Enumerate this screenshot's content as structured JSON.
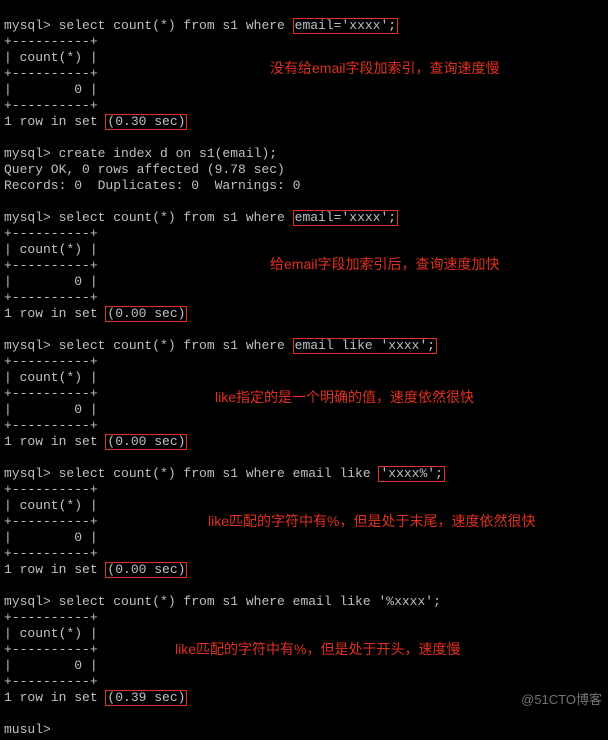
{
  "common": {
    "prompt": "mysql>",
    "divider": "+----------+",
    "header": "| count(*) |",
    "value": "|        0 |",
    "rowPrefix": "1 row in set "
  },
  "queries": {
    "q1_before": "mysql> select count(*) from s1 where ",
    "q1_box": "email='xxxx';",
    "q1_time": "(0.30 sec)",
    "createIdx": "mysql> create index d on s1(email);",
    "createOut1": "Query OK, 0 rows affected (9.78 sec)",
    "createOut2": "Records: 0  Duplicates: 0  Warnings: 0",
    "q2_before": "mysql> select count(*) from s1 where ",
    "q2_box": "email='xxxx';",
    "q2_time": "(0.00 sec)",
    "q3_before": "mysql> select count(*) from s1 where ",
    "q3_box": "email like 'xxxx';",
    "q3_time": "(0.00 sec)",
    "q4_before": "mysql> select count(*) from s1 where email like ",
    "q4_box": "'xxxx%';",
    "q4_time": "(0.00 sec)",
    "q5_before": "mysql> select count(*) from s1 where email like '%xxxx';",
    "q5_time": "(0.39 sec)",
    "trailing": "musul>"
  },
  "comments": {
    "c1": "没有给email字段加索引，查询速度慢",
    "c2": "给email字段加索引后，查询速度加快",
    "c3": "like指定的是一个明确的值，速度依然很快",
    "c4": "like匹配的字符中有%，但是处于末尾，速度依然很快",
    "c5": "like匹配的字符中有%，但是处于开头，速度慢"
  },
  "watermark": "@51CTO博客"
}
